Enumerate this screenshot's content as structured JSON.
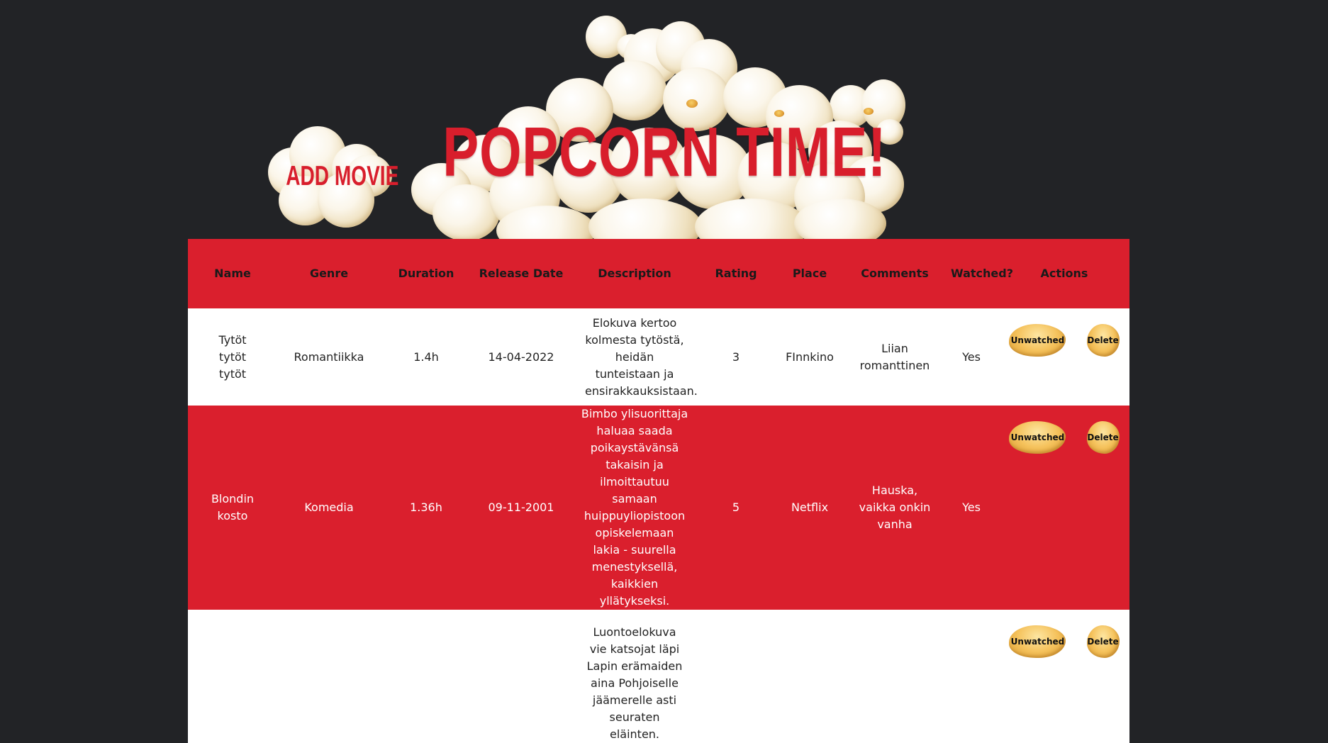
{
  "header": {
    "title": "POPCORN TIME!",
    "add_movie": "ADD MOVIE"
  },
  "colors": {
    "accent": "#da1f2d",
    "background": "#222326",
    "white": "#ffffff"
  },
  "table": {
    "columns": [
      "Name",
      "Genre",
      "Duration",
      "Release Date",
      "Description",
      "Rating",
      "Place",
      "Comments",
      "Watched?",
      "Actions"
    ],
    "rows": [
      {
        "name": "Tytöt tytöt tytöt",
        "genre": "Romantiikka",
        "duration": "1.4h",
        "release": "14-04-2022",
        "description": "Elokuva kertoo kolmesta tytöstä, heidän tunteistaan ja ensirakkauksistaan.",
        "rating": "3",
        "place": "FInnkino",
        "comments": "Liian romanttinen",
        "watched": "Yes",
        "watch_btn": "Unwatched",
        "delete_btn": "Delete"
      },
      {
        "name": "Blondin kosto",
        "genre": "Komedia",
        "duration": "1.36h",
        "release": "09-11-2001",
        "description": "Bimbo ylisuorittaja haluaa saada poikaystävänsä takaisin ja ilmoittautuu samaan huippuyliopistoon opiskelemaan lakia - suurella menestyksellä, kaikkien yllätykseksi.",
        "rating": "5",
        "place": "Netflix",
        "comments": "Hauska, vaikka onkin vanha",
        "watched": "Yes",
        "watch_btn": "Unwatched",
        "delete_btn": "Delete"
      },
      {
        "name": "",
        "genre": "",
        "duration": "",
        "release": "",
        "description": "Luontoelokuva vie katsojat läpi Lapin erämaiden aina Pohjoiselle jäämerelle asti seuraten eläinten.",
        "rating": "",
        "place": "",
        "comments": "",
        "watched": "",
        "watch_btn": "Unwatched",
        "delete_btn": "Delete"
      }
    ]
  }
}
